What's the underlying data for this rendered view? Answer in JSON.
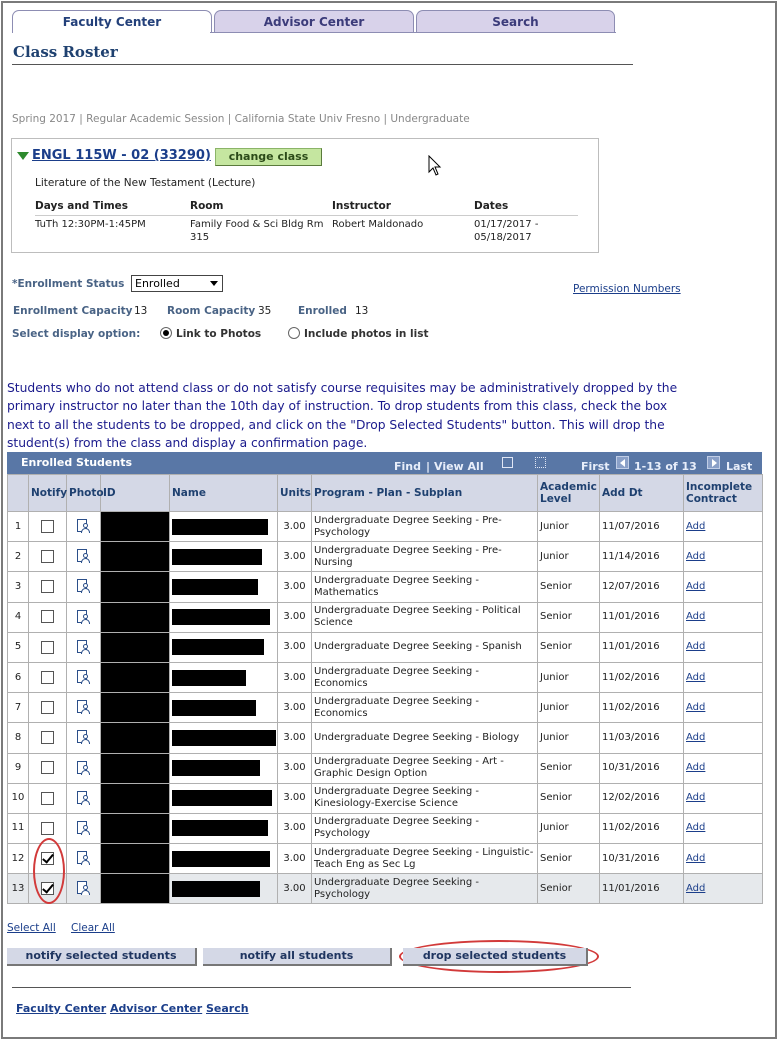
{
  "tabs": [
    {
      "label": "Faculty Center",
      "active": true
    },
    {
      "label": "Advisor Center",
      "active": false
    },
    {
      "label": "Search",
      "active": false
    }
  ],
  "page_title": "Class Roster",
  "term_line": "Spring 2017 | Regular Academic Session | California State Univ  Fresno | Undergraduate",
  "class_info": {
    "link": "ENGL 115W - 02 (33290)",
    "change_button": "change class",
    "description": "Literature of the New Testament (Lecture)",
    "headers": [
      "Days and Times",
      "Room",
      "Instructor",
      "Dates"
    ],
    "days_times": "TuTh 12:30PM-1:45PM",
    "room": "Family Food & Sci Bldg Rm 315",
    "instructor": "Robert Maldonado",
    "dates": "01/17/2017 - 05/18/2017"
  },
  "enrollment": {
    "status_label": "*Enrollment Status",
    "status_value": "Enrolled",
    "permission_link": "Permission Numbers",
    "capacity_label": "Enrollment Capacity",
    "capacity_value": "13",
    "room_capacity_label": "Room Capacity",
    "room_capacity_value": "35",
    "enrolled_label": "Enrolled",
    "enrolled_value": "13",
    "display_label": "Select display option:",
    "option_photos_link": "Link to Photos",
    "option_photos_list": "Include photos in list",
    "selected_option": "Link to Photos"
  },
  "notice": "Students who do not attend class or do not satisfy course requisites may be administratively dropped by the primary instructor no later than the 10th day of instruction. To drop students from this class, check the box next to all the students to be dropped, and click on the \"Drop Selected Students\" button. This will drop the student(s) from the class and display a confirmation page.",
  "grid": {
    "title": "Enrolled Students",
    "find": "Find",
    "separator": "|",
    "view_all": "View All",
    "first": "First",
    "range": "1-13 of 13",
    "last": "Last",
    "columns": [
      "",
      "Notify",
      "Photo",
      "ID",
      "Name",
      "Units",
      "Program - Plan - Subplan",
      "Academic Level",
      "Add Dt",
      "Incomplete Contract"
    ],
    "rows": [
      {
        "num": "1",
        "checked": false,
        "units": "3.00",
        "program": "Undergraduate Degree Seeking - Pre-Psychology",
        "level": "Junior",
        "add_dt": "11/07/2016",
        "contract": "Add",
        "redact_w": 96
      },
      {
        "num": "2",
        "checked": false,
        "units": "3.00",
        "program": "Undergraduate Degree Seeking - Pre-Nursing",
        "level": "Junior",
        "add_dt": "11/14/2016",
        "contract": "Add",
        "redact_w": 90
      },
      {
        "num": "3",
        "checked": false,
        "units": "3.00",
        "program": "Undergraduate Degree Seeking - Mathematics",
        "level": "Senior",
        "add_dt": "12/07/2016",
        "contract": "Add",
        "redact_w": 86
      },
      {
        "num": "4",
        "checked": false,
        "units": "3.00",
        "program": "Undergraduate Degree Seeking - Political Science",
        "level": "Senior",
        "add_dt": "11/01/2016",
        "contract": "Add",
        "redact_w": 98
      },
      {
        "num": "5",
        "checked": false,
        "units": "3.00",
        "program": "Undergraduate Degree Seeking - Spanish",
        "level": "Senior",
        "add_dt": "11/01/2016",
        "contract": "Add",
        "redact_w": 92
      },
      {
        "num": "6",
        "checked": false,
        "units": "3.00",
        "program": "Undergraduate Degree Seeking - Economics",
        "level": "Junior",
        "add_dt": "11/02/2016",
        "contract": "Add",
        "redact_w": 74
      },
      {
        "num": "7",
        "checked": false,
        "units": "3.00",
        "program": "Undergraduate Degree Seeking - Economics",
        "level": "Junior",
        "add_dt": "11/02/2016",
        "contract": "Add",
        "redact_w": 84
      },
      {
        "num": "8",
        "checked": false,
        "units": "3.00",
        "program": "Undergraduate Degree Seeking - Biology",
        "level": "Junior",
        "add_dt": "11/03/2016",
        "contract": "Add",
        "redact_w": 104
      },
      {
        "num": "9",
        "checked": false,
        "units": "3.00",
        "program": "Undergraduate Degree Seeking - Art - Graphic Design Option",
        "level": "Senior",
        "add_dt": "10/31/2016",
        "contract": "Add",
        "redact_w": 88
      },
      {
        "num": "10",
        "checked": false,
        "units": "3.00",
        "program": "Undergraduate Degree Seeking - Kinesiology-Exercise Science",
        "level": "Senior",
        "add_dt": "12/02/2016",
        "contract": "Add",
        "redact_w": 100
      },
      {
        "num": "11",
        "checked": false,
        "units": "3.00",
        "program": "Undergraduate Degree Seeking - Psychology",
        "level": "Junior",
        "add_dt": "11/02/2016",
        "contract": "Add",
        "redact_w": 96
      },
      {
        "num": "12",
        "checked": true,
        "units": "3.00",
        "program": "Undergraduate Degree Seeking - Linguistic-Teach Eng as Sec Lg",
        "level": "Senior",
        "add_dt": "10/31/2016",
        "contract": "Add",
        "redact_w": 98
      },
      {
        "num": "13",
        "checked": true,
        "units": "3.00",
        "program": "Undergraduate Degree Seeking - Psychology",
        "level": "Senior",
        "add_dt": "11/01/2016",
        "contract": "Add",
        "redact_w": 88
      }
    ]
  },
  "select_all": "Select All",
  "clear_all": "Clear All",
  "buttons": {
    "notify_selected": "notify selected students",
    "notify_all": "notify all students",
    "drop_selected": "drop selected students"
  },
  "footer_links": [
    "Faculty Center",
    "Advisor Center",
    "Search"
  ]
}
